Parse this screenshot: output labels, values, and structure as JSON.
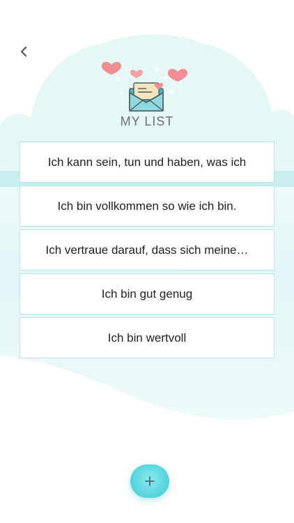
{
  "header": {
    "title": "MY LIST",
    "back_icon": "chevron-left-icon",
    "illustration_icon": "envelope-hearts-icon"
  },
  "items": [
    {
      "text": "Ich kann sein, tun und haben, was ich"
    },
    {
      "text": "Ich bin vollkommen so wie ich bin."
    },
    {
      "text": "Ich vertraue darauf, dass sich meine…"
    },
    {
      "text": "Ich bin gut genug"
    },
    {
      "text": "Ich bin wertvoll"
    }
  ],
  "fab": {
    "icon": "plus-icon"
  },
  "colors": {
    "accent": "#5ad6df",
    "cloud_top": "#eaf7f9",
    "cloud_bottom": "#c9eef0",
    "border": "#b7e8eb",
    "heart": "#f08e93",
    "title_text": "#6f6f6f"
  }
}
